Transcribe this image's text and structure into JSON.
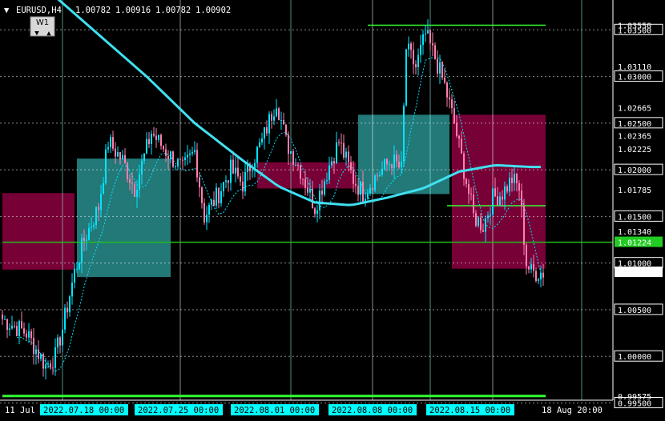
{
  "header": {
    "menu_glyph": "▼",
    "symbol": "EURUSD,H4",
    "open": "1.00782",
    "high": "1.00916",
    "low": "1.00782",
    "close": "1.00902"
  },
  "timeframe_widget": {
    "label": "W1",
    "up": "▲",
    "down": "▼"
  },
  "colors": {
    "background": "#000000",
    "bull": "#00E5FF",
    "bear": "#FF7FB0",
    "ma": "#40E0F0",
    "green_level": "#33FF33",
    "grid": "#FFFFFF",
    "zone_bear": "#8C0040",
    "zone_bull": "#2FA0A0",
    "label_hl_bg": "#00FFFF"
  },
  "chart_data": {
    "type": "candlestick",
    "symbol": "EURUSD",
    "timeframe": "H4",
    "ylim": [
      0.9953,
      1.0382
    ],
    "y_ticks": [
      "1.03500",
      "1.03000",
      "1.02500",
      "1.02000",
      "1.01500",
      "1.01000",
      "1.00500",
      "1.00000",
      "0.99500"
    ],
    "extra_price_labels": [
      "1.03550",
      "1.03110",
      "1.02665",
      "1.02365",
      "1.02225",
      "1.01785",
      "1.01340",
      "0.99575"
    ],
    "current_price_label": "1.00902",
    "green_level_label": "1.01224",
    "time_labels": [
      {
        "text": "11 Jul 20",
        "highlight": false
      },
      {
        "text": "2022.07.18 00:00",
        "highlight": true
      },
      {
        "text": "2022.07.25 00:00",
        "highlight": true
      },
      {
        "text": "2022.08.01 00:00",
        "highlight": true
      },
      {
        "text": "2022.08.08 00:00",
        "highlight": true
      },
      {
        "text": "2022.08.15 00:00",
        "highlight": true
      },
      {
        "text": "18 Aug 20:00",
        "highlight": false
      }
    ],
    "horizontal_levels": [
      1.0355,
      1.01615,
      1.01224,
      0.99575
    ],
    "zones": [
      {
        "type": "bear",
        "from_bar": 0,
        "to_bar": 30,
        "top": 1.0175,
        "bottom": 1.0093
      },
      {
        "type": "bull",
        "from_bar": 31,
        "to_bar": 70,
        "top": 1.0212,
        "bottom": 1.0085
      },
      {
        "type": "bear",
        "from_bar": 106,
        "to_bar": 147,
        "top": 1.0208,
        "bottom": 1.018
      },
      {
        "type": "bull",
        "from_bar": 148,
        "to_bar": 186,
        "top": 1.0259,
        "bottom": 1.0174
      },
      {
        "type": "bear",
        "from_bar": 187,
        "to_bar": 226,
        "top": 1.0259,
        "bottom": 1.0094
      }
    ],
    "key_closes": [
      [
        0,
        1.004
      ],
      [
        10,
        1.0025
      ],
      [
        18,
        0.999
      ],
      [
        22,
        1.0
      ],
      [
        25,
        1.003
      ],
      [
        30,
        1.009
      ],
      [
        34,
        1.0125
      ],
      [
        40,
        1.016
      ],
      [
        44,
        1.023
      ],
      [
        50,
        1.021
      ],
      [
        55,
        1.018
      ],
      [
        62,
        1.024
      ],
      [
        68,
        1.022
      ],
      [
        75,
        1.02
      ],
      [
        80,
        1.022
      ],
      [
        84,
        1.015
      ],
      [
        90,
        1.0175
      ],
      [
        95,
        1.02
      ],
      [
        100,
        1.0185
      ],
      [
        104,
        1.021
      ],
      [
        108,
        1.023
      ],
      [
        114,
        1.0275
      ],
      [
        118,
        1.023
      ],
      [
        124,
        1.02
      ],
      [
        130,
        1.016
      ],
      [
        136,
        1.0205
      ],
      [
        140,
        1.023
      ],
      [
        146,
        1.019
      ],
      [
        150,
        1.0175
      ],
      [
        156,
        1.0195
      ],
      [
        162,
        1.021
      ],
      [
        166,
        1.02
      ],
      [
        168,
        1.033
      ],
      [
        172,
        1.031
      ],
      [
        176,
        1.0345
      ],
      [
        180,
        1.032
      ],
      [
        184,
        1.029
      ],
      [
        188,
        1.025
      ],
      [
        192,
        1.02
      ],
      [
        196,
        1.015
      ],
      [
        200,
        1.014
      ],
      [
        204,
        1.017
      ],
      [
        208,
        1.0175
      ],
      [
        212,
        1.019
      ],
      [
        215,
        1.018
      ],
      [
        218,
        1.01
      ],
      [
        220,
        1.009
      ]
    ],
    "ma_points": [
      [
        0,
        1.043
      ],
      [
        20,
        1.039
      ],
      [
        40,
        1.0345
      ],
      [
        60,
        1.03
      ],
      [
        80,
        1.025
      ],
      [
        100,
        1.021
      ],
      [
        115,
        1.0182
      ],
      [
        130,
        1.0165
      ],
      [
        145,
        1.0162
      ],
      [
        160,
        1.017
      ],
      [
        175,
        1.018
      ],
      [
        190,
        1.0198
      ],
      [
        205,
        1.0205
      ],
      [
        220,
        1.0203
      ]
    ]
  }
}
